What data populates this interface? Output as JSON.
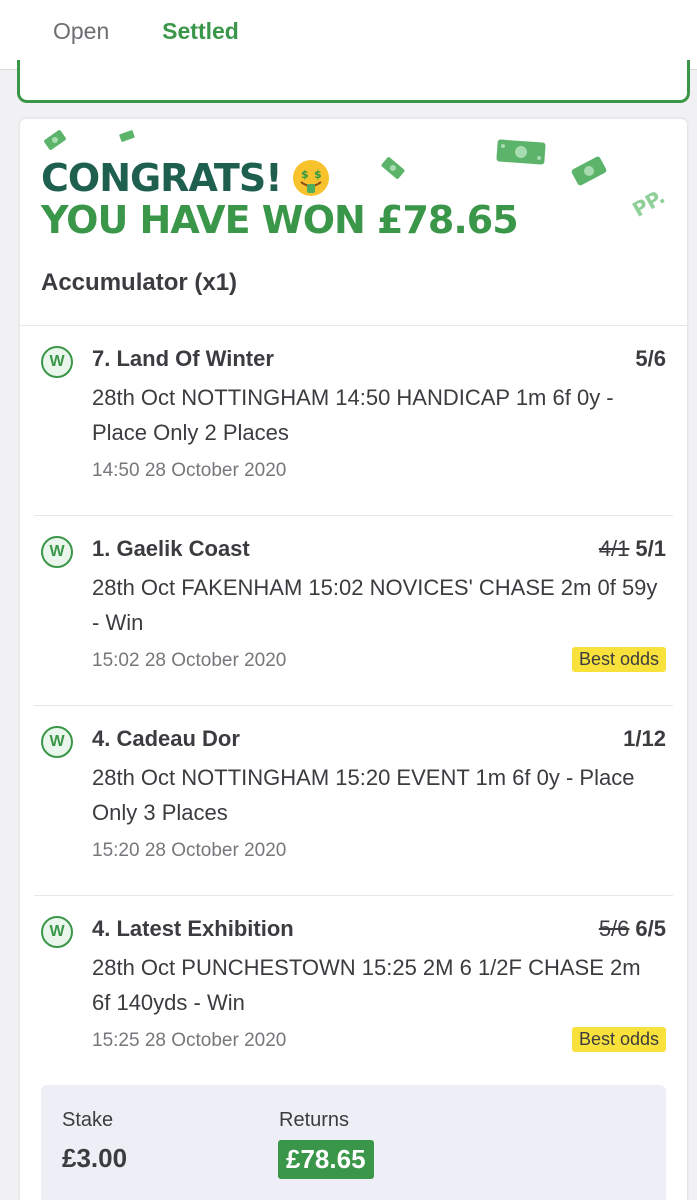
{
  "tabs": [
    {
      "label": "Open"
    },
    {
      "label": "Settled",
      "active": true
    }
  ],
  "banner": {
    "congrats": "CONGRATS!",
    "won": "YOU HAVE WON £78.65",
    "emoji": "money-mouth-face-icon",
    "watermark": "PP."
  },
  "bet": {
    "type": "Accumulator (x1)",
    "legs": [
      {
        "status": "W",
        "selection": "7. Land Of Winter",
        "old_odds": "",
        "odds": "5/6",
        "event": "28th Oct NOTTINGHAM 14:50 HANDICAP 1m 6f 0y - Place Only 2 Places",
        "time": "14:50 28 October 2020",
        "best_odds": ""
      },
      {
        "status": "W",
        "selection": "1. Gaelik Coast",
        "old_odds": "4/1",
        "odds": "5/1",
        "event": "28th Oct FAKENHAM 15:02 NOVICES' CHASE 2m 0f 59y - Win",
        "time": "15:02 28 October 2020",
        "best_odds": "Best odds"
      },
      {
        "status": "W",
        "selection": "4. Cadeau Dor",
        "old_odds": "",
        "odds": "1/12",
        "event": "28th Oct NOTTINGHAM 15:20 EVENT 1m 6f 0y - Place Only 3 Places",
        "time": "15:20 28 October 2020",
        "best_odds": ""
      },
      {
        "status": "W",
        "selection": "4. Latest Exhibition",
        "old_odds": "5/6",
        "odds": "6/5",
        "event": "28th Oct PUNCHESTOWN 15:25 2M 6 1/2F CHASE 2m 6f 140yds - Win",
        "time": "15:25 28 October 2020",
        "best_odds": "Best odds"
      }
    ],
    "stake_label": "Stake",
    "stake": "£3.00",
    "returns_label": "Returns",
    "returns": "£78.65"
  },
  "colors": {
    "brand_green": "#3a9648",
    "dark_green": "#1f5f4e",
    "best_odds_yellow": "#f8e13a"
  }
}
